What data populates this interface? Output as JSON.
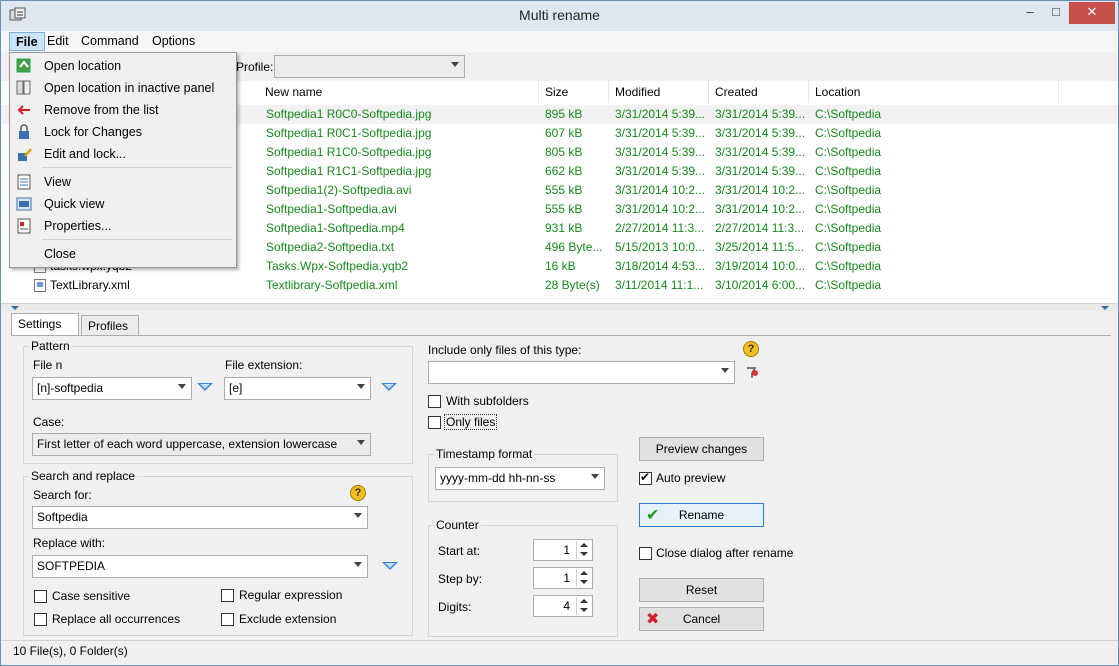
{
  "window": {
    "title": "Multi rename",
    "close_label": "✕",
    "max_label": "□",
    "min_label": "–"
  },
  "menubar": [
    "File",
    "Edit",
    "Command",
    "Options"
  ],
  "file_menu": {
    "items": [
      {
        "label": "Open location",
        "icon": "open-location-icon"
      },
      {
        "label": "Open location in inactive panel",
        "icon": "open-inactive-icon"
      },
      {
        "label": "Remove from the list",
        "icon": "remove-icon"
      },
      {
        "label": "Lock for Changes",
        "icon": "lock-icon"
      },
      {
        "label": "Edit and lock...",
        "icon": "edit-lock-icon"
      },
      {
        "label": "View",
        "icon": "view-icon"
      },
      {
        "label": "Quick view",
        "icon": "quick-view-icon"
      },
      {
        "label": "Properties...",
        "icon": "properties-icon"
      },
      {
        "label": "Close",
        "icon": ""
      }
    ]
  },
  "profile": {
    "label": "Profile:",
    "value": ""
  },
  "list": {
    "headers": [
      "New name",
      "Size",
      "Modified",
      "Created",
      "Location"
    ],
    "rows": [
      {
        "old": "",
        "new": "Softpedia1 R0C0-Softpedia.jpg",
        "size": "895 kB",
        "modified": "3/31/2014 5:39...",
        "created": "3/31/2014 5:39...",
        "location": "C:\\Softpedia"
      },
      {
        "old": "",
        "new": "Softpedia1 R0C1-Softpedia.jpg",
        "size": "607 kB",
        "modified": "3/31/2014 5:39...",
        "created": "3/31/2014 5:39...",
        "location": "C:\\Softpedia"
      },
      {
        "old": "",
        "new": "Softpedia1 R1C0-Softpedia.jpg",
        "size": "805 kB",
        "modified": "3/31/2014 5:39...",
        "created": "3/31/2014 5:39...",
        "location": "C:\\Softpedia"
      },
      {
        "old": "",
        "new": "Softpedia1 R1C1-Softpedia.jpg",
        "size": "662 kB",
        "modified": "3/31/2014 5:39...",
        "created": "3/31/2014 5:39...",
        "location": "C:\\Softpedia"
      },
      {
        "old": "",
        "new": "Softpedia1(2)-Softpedia.avi",
        "size": "555 kB",
        "modified": "3/31/2014 10:2...",
        "created": "3/31/2014 10:2...",
        "location": "C:\\Softpedia"
      },
      {
        "old": "",
        "new": "Softpedia1-Softpedia.avi",
        "size": "555 kB",
        "modified": "3/31/2014 10:2...",
        "created": "3/31/2014 10:2...",
        "location": "C:\\Softpedia"
      },
      {
        "old": "",
        "new": "Softpedia1-Softpedia.mp4",
        "size": "931 kB",
        "modified": "2/27/2014 11:3...",
        "created": "2/27/2014 11:3...",
        "location": "C:\\Softpedia"
      },
      {
        "old": "",
        "new": "Softpedia2-Softpedia.txt",
        "size": "496 Byte...",
        "modified": "5/15/2013 10:0...",
        "created": "3/25/2014 11:5...",
        "location": "C:\\Softpedia"
      },
      {
        "old": "tasks.wpx.yqb2",
        "new": "Tasks.Wpx-Softpedia.yqb2",
        "size": "16 kB",
        "modified": "3/18/2014 4:53...",
        "created": "3/19/2014 10:0...",
        "location": "C:\\Softpedia"
      },
      {
        "old": "TextLibrary.xml",
        "new": "Textlibrary-Softpedia.xml",
        "size": "28 Byte(s)",
        "modified": "3/11/2014 11:1...",
        "created": "3/10/2014 6:00...",
        "location": "C:\\Softpedia"
      }
    ]
  },
  "tabs": [
    "Settings",
    "Profiles"
  ],
  "pattern": {
    "group": "Pattern",
    "file_label": "File n",
    "file_value": "[n]-softpedia",
    "ext_label": "File extension:",
    "ext_value": "[e]",
    "case_label": "Case:",
    "case_value": "First letter of each word uppercase, extension lowercase"
  },
  "search": {
    "group": "Search and replace",
    "search_label": "Search for:",
    "search_value": "Softpedia",
    "replace_label": "Replace with:",
    "replace_value": "SOFTPEDIA",
    "case_sensitive": "Case sensitive",
    "replace_all": "Replace all occurrences",
    "regex": "Regular expression",
    "exclude_ext": "Exclude extension"
  },
  "filter": {
    "label": "Include only files of this type:",
    "value": "",
    "subfolders": "With subfolders",
    "only_files": "Only files"
  },
  "timestamp": {
    "group": "Timestamp format",
    "value": "yyyy-mm-dd hh-nn-ss"
  },
  "counter": {
    "group": "Counter",
    "start_label": "Start at:",
    "start_value": "1",
    "step_label": "Step by:",
    "step_value": "1",
    "digits_label": "Digits:",
    "digits_value": "4"
  },
  "actions": {
    "preview": "Preview changes",
    "auto_preview": "Auto preview",
    "rename": "Rename",
    "close_after": "Close dialog after rename",
    "reset": "Reset",
    "cancel": "Cancel"
  },
  "status": {
    "text": "10 File(s), 0 Folder(s)"
  },
  "colors": {
    "accent": "#2f7cc7",
    "green_text": "#16891c",
    "close_button": "#c7504a"
  }
}
